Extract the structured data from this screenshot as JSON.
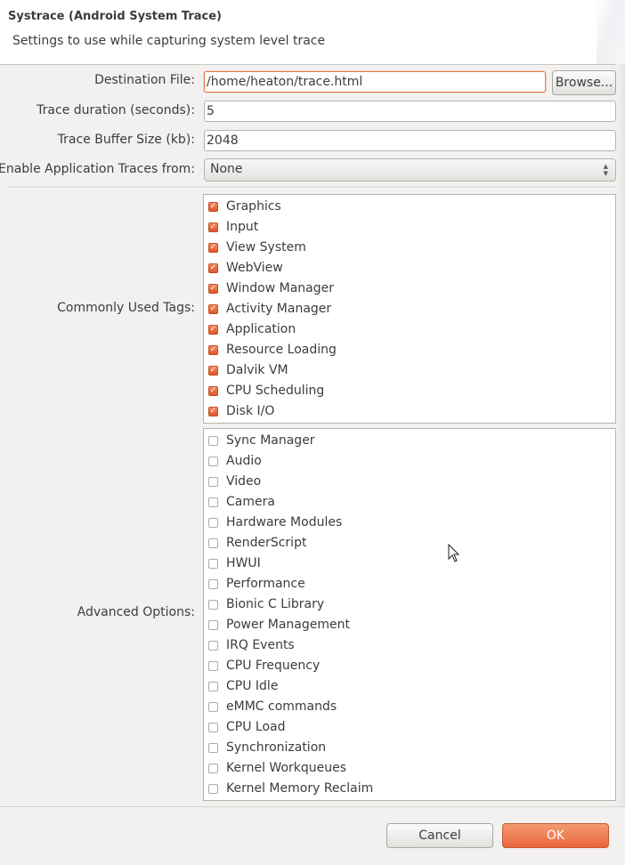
{
  "dialog": {
    "title": "Systrace (Android System Trace)",
    "subtitle": "Settings to use while capturing system level trace"
  },
  "form": {
    "destination_label": "Destination File:",
    "destination_value": "/home/heaton/trace.html",
    "browse_label": "Browse...",
    "duration_label": "Trace duration (seconds):",
    "duration_value": "5",
    "buffer_label": "Trace Buffer Size (kb):",
    "buffer_value": "2048",
    "app_traces_label": "Enable Application Traces from:",
    "app_traces_value": "None"
  },
  "common_tags": {
    "label": "Commonly Used Tags:",
    "items": [
      {
        "label": "Graphics",
        "checked": true
      },
      {
        "label": "Input",
        "checked": true
      },
      {
        "label": "View System",
        "checked": true
      },
      {
        "label": "WebView",
        "checked": true
      },
      {
        "label": "Window Manager",
        "checked": true
      },
      {
        "label": "Activity Manager",
        "checked": true
      },
      {
        "label": "Application",
        "checked": true
      },
      {
        "label": "Resource Loading",
        "checked": true
      },
      {
        "label": "Dalvik VM",
        "checked": true
      },
      {
        "label": "CPU Scheduling",
        "checked": true
      },
      {
        "label": "Disk I/O",
        "checked": true
      }
    ]
  },
  "advanced": {
    "label": "Advanced Options:",
    "items": [
      {
        "label": "Sync Manager",
        "checked": false
      },
      {
        "label": "Audio",
        "checked": false
      },
      {
        "label": "Video",
        "checked": false
      },
      {
        "label": "Camera",
        "checked": false
      },
      {
        "label": "Hardware Modules",
        "checked": false
      },
      {
        "label": "RenderScript",
        "checked": false
      },
      {
        "label": "HWUI",
        "checked": false
      },
      {
        "label": "Performance",
        "checked": false
      },
      {
        "label": "Bionic C Library",
        "checked": false
      },
      {
        "label": "Power Management",
        "checked": false
      },
      {
        "label": "IRQ Events",
        "checked": false
      },
      {
        "label": "CPU Frequency",
        "checked": false
      },
      {
        "label": "CPU Idle",
        "checked": false
      },
      {
        "label": "eMMC commands",
        "checked": false
      },
      {
        "label": "CPU Load",
        "checked": false
      },
      {
        "label": "Synchronization",
        "checked": false
      },
      {
        "label": "Kernel Workqueues",
        "checked": false
      },
      {
        "label": "Kernel Memory Reclaim",
        "checked": false
      }
    ]
  },
  "buttons": {
    "cancel": "Cancel",
    "ok": "OK"
  },
  "colors": {
    "accent": "#e8673a",
    "checkbox_checked": "#e0572b",
    "dialog_background": "#f2f1f0"
  },
  "icons": {
    "checkbox_checkmark": "check-mark",
    "combo_arrows": "up-down-arrows",
    "pointer": "mouse-pointer"
  }
}
